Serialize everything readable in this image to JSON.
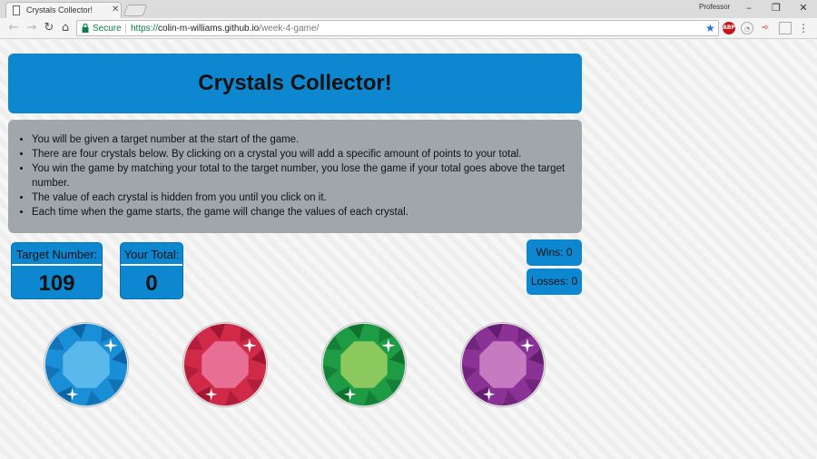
{
  "browser": {
    "tab_title": "Crystals Collector!",
    "profile_name": "Professor",
    "secure_label": "Secure",
    "url_scheme": "https://",
    "url_host": "colin-m-williams.github.io",
    "url_path": "/week-4-game/"
  },
  "page": {
    "title": "Crystals Collector!",
    "instructions": [
      "You will be given a target number at the start of the game.",
      "There are four crystals below. By clicking on a crystal you will add a specific amount of points to your total.",
      "You win the game by matching your total to the target number, you lose the game if your total goes above the target number.",
      "The value of each crystal is hidden from you until you click on it.",
      "Each time when the game starts, the game will change the values of each crystal."
    ],
    "target_label": "Target Number:",
    "target_value": "109",
    "total_label": "Your Total:",
    "total_value": "0",
    "wins_text": "Wins: 0",
    "losses_text": "Losses: 0"
  },
  "crystals": [
    {
      "name": "blue-crystal",
      "color": "#1a8fd8",
      "light": "#5ab8ea",
      "dark": "#0c5d99"
    },
    {
      "name": "red-crystal",
      "color": "#d02a48",
      "light": "#e86e96",
      "dark": "#9a1230"
    },
    {
      "name": "green-crystal",
      "color": "#1e9c45",
      "light": "#8bc85d",
      "dark": "#0f6a2c"
    },
    {
      "name": "purple-crystal",
      "color": "#8b3296",
      "light": "#c67bc0",
      "dark": "#5c1c68"
    }
  ],
  "colors": {
    "header_bg": "#0d87d0",
    "instructions_bg": "#a0a6a9",
    "box_bg": "#0d87d0"
  }
}
